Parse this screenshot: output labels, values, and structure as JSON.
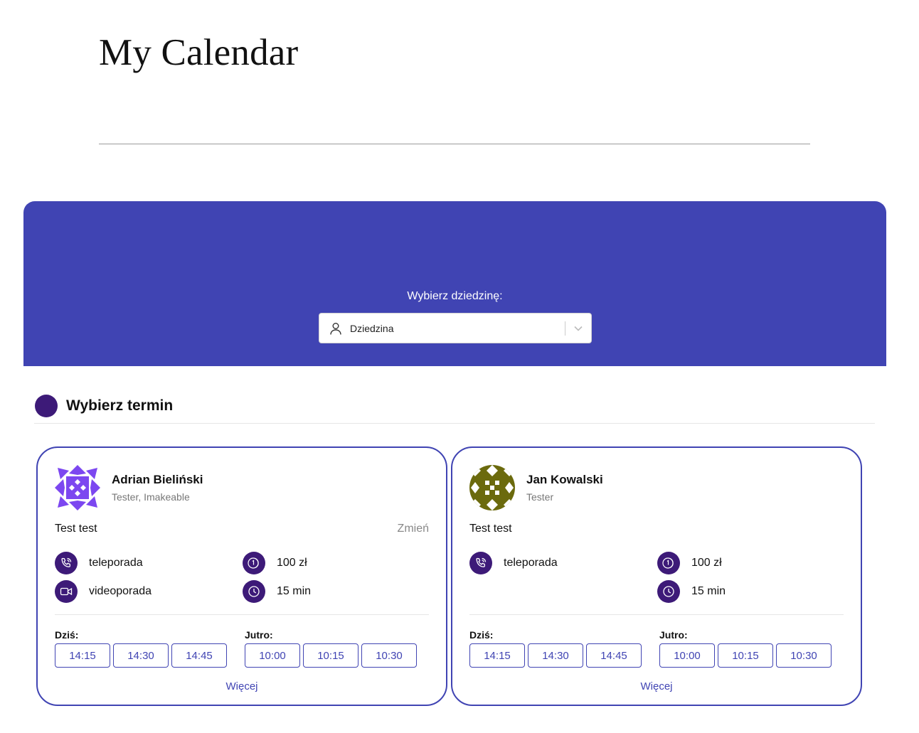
{
  "page": {
    "title": "My Calendar"
  },
  "banner": {
    "label": "Wybierz dziedzinę:",
    "select": {
      "value": "Dziedzina",
      "icon": "person-icon"
    },
    "background": "#4044b3"
  },
  "section": {
    "title": "Wybierz termin",
    "accent": "#3d1a78"
  },
  "cards": [
    {
      "name": "Adrian Bieliński",
      "role": "Tester, Imakeable",
      "service": "Test test",
      "change_label": "Zmień",
      "types": [
        {
          "icon": "phone-icon",
          "label": "teleporada"
        },
        {
          "icon": "video-icon",
          "label": "videoporada"
        }
      ],
      "price": "100 zł",
      "duration": "15 min",
      "today_label": "Dziś:",
      "today_slots": [
        "14:15",
        "14:30",
        "14:45"
      ],
      "tomorrow_label": "Jutro:",
      "tomorrow_slots": [
        "10:00",
        "10:15",
        "10:30"
      ],
      "more_label": "Więcej"
    },
    {
      "name": "Jan Kowalski",
      "role": "Tester",
      "service": "Test test",
      "types": [
        {
          "icon": "phone-icon",
          "label": "teleporada"
        }
      ],
      "price": "100 zł",
      "duration": "15 min",
      "today_label": "Dziś:",
      "today_slots": [
        "14:15",
        "14:30",
        "14:45"
      ],
      "tomorrow_label": "Jutro:",
      "tomorrow_slots": [
        "10:00",
        "10:15",
        "10:30"
      ],
      "more_label": "Więcej"
    }
  ]
}
